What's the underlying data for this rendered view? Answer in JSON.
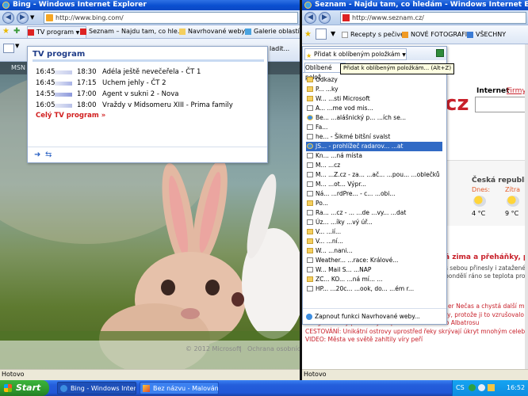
{
  "left_window": {
    "title": "Bing - Windows Internet Explorer",
    "url": "http://www.bing.com/",
    "fav_items": [
      "TV program",
      "Seznam – Najdu tam, co hle...",
      "Navrhované weby",
      "Galerie oblastí Web Sl"
    ],
    "cmd_partial": "ladit...",
    "msn_label": "MSN",
    "tv_popup": {
      "title": "TV program",
      "rows": [
        {
          "start": "16:45",
          "end": "18:30",
          "show": "Adéla ještě nevečeřela - ČT 1"
        },
        {
          "start": "16:45",
          "end": "17:15",
          "show": "Uchem jehly - ČT 2"
        },
        {
          "start": "14:55",
          "end": "17:00",
          "show": "Agent v sukni 2 - Nova"
        },
        {
          "start": "16:05",
          "end": "18:00",
          "show": "Vraždy v Midsomeru XIII - Prima family"
        }
      ],
      "all_link": "Celý TV program »"
    },
    "footer_copyright": "© 2012 Microsoft",
    "footer_separator": "|",
    "footer_privacy": "Ochrana osobních",
    "status": "Hotovo"
  },
  "right_window": {
    "title": "Seznam - Najdu tam, co hledám - Windows Internet Explorer",
    "url": "http://www.seznam.cz/",
    "fav_items": [
      "Recepty s pečive...",
      "NOVÉ FOTOGRAFIE",
      "VŠECHNY"
    ],
    "add_favorites_button": "Přidat k oblíbeným položkám",
    "add_favorites_tooltip": "Přidat k oblíbeným položkám... (Alt+Z)",
    "favorites_tab": "Oblíbené polož",
    "favorites": [
      {
        "icon": "folder",
        "label": "Odkazy"
      },
      {
        "icon": "folder",
        "label": "P... ...ky"
      },
      {
        "icon": "folder",
        "label": "W... ...sti Microsoft"
      },
      {
        "icon": "page",
        "label": "A... ...me vod mis..."
      },
      {
        "icon": "ie",
        "label": "Be... ...alášnický p... ...ích se..."
      },
      {
        "icon": "page",
        "label": "Fa..."
      },
      {
        "icon": "page",
        "label": "he... - Šikmé bitšní svalst"
      },
      {
        "icon": "ie",
        "label": "JS... - prohlížeč radarov... ...at"
      },
      {
        "icon": "page",
        "label": "Kn... ...ná místa"
      },
      {
        "icon": "page",
        "label": "M... ...cz"
      },
      {
        "icon": "page",
        "label": "M... ...Z.cz - za... ...ač... ...pou... ...oblečků a..."
      },
      {
        "icon": "page",
        "label": "M... ...ot... Výpr..."
      },
      {
        "icon": "page",
        "label": "Ná... ...rdPre... - c... ...obi..."
      },
      {
        "icon": "folder",
        "label": "Po..."
      },
      {
        "icon": "page",
        "label": "Ra... ...cz - ...  ...de ...vy... ...dat"
      },
      {
        "icon": "page",
        "label": "Úz... ...íky ...vý úř..."
      },
      {
        "icon": "folder",
        "label": "V... ...ií..."
      },
      {
        "icon": "folder",
        "label": "V... ...ní..."
      },
      {
        "icon": "folder",
        "label": "W... ...nani..."
      },
      {
        "icon": "page",
        "label": "Weather... ...race: Králové..."
      },
      {
        "icon": "page",
        "label": "W... Mail S... ...NAP"
      },
      {
        "icon": "folder",
        "label": "ZC... KO... ...ná mí... ..."
      },
      {
        "icon": "page",
        "label": "HP... ...20c... ...ook, do... ...ém r..."
      }
    ],
    "suggested_sites_link": "Zapnout funkci Navrhované weby...",
    "search_tab_internet": "Internet",
    "search_tab_firmy": "Firmy",
    "logo_partial": "cz",
    "weather_title": "Česká republika",
    "weather_today_label": "Dnes:",
    "weather_tomorrow_label": "Zítra",
    "weather_today_temp": "4 °C",
    "weather_tomorrow_temp": "9 °C",
    "headline_big": "ā zima a přeháňky, pak",
    "news_lines": [
      "s sebou přinesly i zatažené",
      "pondělí ráno se teplota prop",
      "",
      "er Nečas a chystá další ma",
      "ry, protože ji to vzrušovalo",
      "Dangadeshský pilot zahynul při nehodě českého Albatrosu",
      "CESTOVÁNÍ: Unikátní ostrovy uprostřed řeky skrývají úkryt mnohým celebrit",
      "VIDEO: Města ve světě zahltily víry peří"
    ],
    "status": "Hotovo"
  },
  "taskbar": {
    "start": "Start",
    "tasks": [
      "Bing - Windows Inter...",
      "Bez názvu - Malování"
    ],
    "lang": "CS",
    "time": "16:52"
  }
}
